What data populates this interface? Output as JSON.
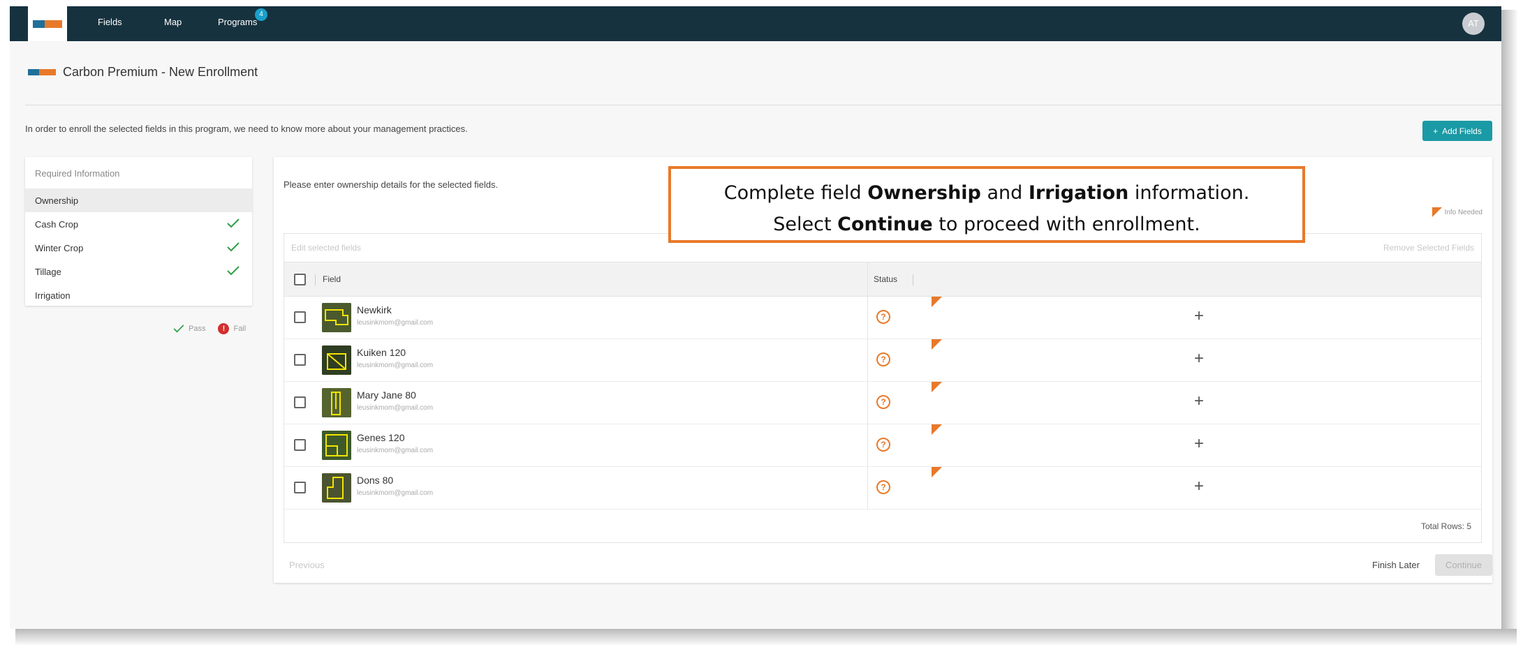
{
  "nav": {
    "links": [
      "Fields",
      "Map",
      "Programs"
    ],
    "programs_badge": "4",
    "avatar_initials": "AT"
  },
  "header": {
    "title": "Carbon Premium - New Enrollment",
    "intro": "In order to enroll the selected fields in this program, we need to know more about your management practices.",
    "add_fields_label": "Add Fields"
  },
  "required_info": {
    "heading": "Required Information",
    "items": [
      {
        "label": "Ownership",
        "active": true,
        "passed": false
      },
      {
        "label": "Cash Crop",
        "active": false,
        "passed": true
      },
      {
        "label": "Winter Crop",
        "active": false,
        "passed": true
      },
      {
        "label": "Tillage",
        "active": false,
        "passed": true
      },
      {
        "label": "Irrigation",
        "active": false,
        "passed": false
      }
    ],
    "legend_pass": "Pass",
    "legend_fail": "Fail"
  },
  "main": {
    "intro": "Please enter ownership details for the selected fields.",
    "info_needed": "Info Needed",
    "edit_selected": "Edit selected fields",
    "remove_selected": "Remove Selected Fields",
    "col_field": "Field",
    "col_status": "Status",
    "rows": [
      {
        "name": "Newkirk",
        "email": "leusinkmom@gmail.com"
      },
      {
        "name": "Kuiken 120",
        "email": "leusinkmom@gmail.com"
      },
      {
        "name": "Mary Jane 80",
        "email": "leusinkmom@gmail.com"
      },
      {
        "name": "Genes 120",
        "email": "leusinkmom@gmail.com"
      },
      {
        "name": "Dons 80",
        "email": "leusinkmom@gmail.com"
      }
    ],
    "total_rows": "Total Rows: 5",
    "previous_label": "Previous",
    "finish_later_label": "Finish Later",
    "continue_label": "Continue"
  },
  "callout": {
    "line1_a": "Complete field ",
    "line1_b": "Ownership",
    "line1_c": " and ",
    "line1_d": "Irrigation",
    "line1_e": " information.",
    "line2_a": "Select ",
    "line2_b": "Continue",
    "line2_c": " to proceed with enrollment."
  },
  "colors": {
    "nav_bg": "#17323f",
    "accent_teal": "#1a9aa5",
    "warning_orange": "#e8792a",
    "pass_green": "#2e9e44",
    "fail_red": "#d32f2f"
  }
}
